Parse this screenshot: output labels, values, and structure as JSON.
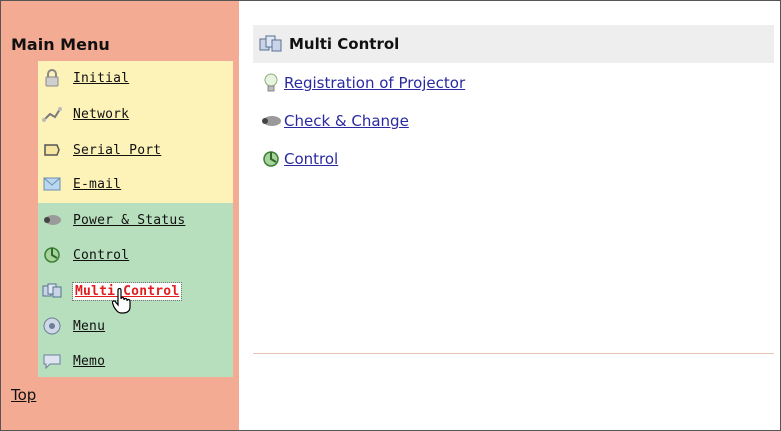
{
  "sidebar": {
    "title": "Main Menu",
    "items": [
      {
        "label": "Initial",
        "icon": "lock-icon"
      },
      {
        "label": "Network",
        "icon": "network-icon"
      },
      {
        "label": "Serial Port",
        "icon": "serial-port-icon"
      },
      {
        "label": "E-mail",
        "icon": "email-icon"
      },
      {
        "label": "Power & Status",
        "icon": "projector-icon"
      },
      {
        "label": "Control",
        "icon": "control-icon"
      },
      {
        "label": "Multi Control",
        "icon": "multi-control-icon",
        "active": true
      },
      {
        "label": "Menu",
        "icon": "menu-icon"
      },
      {
        "label": "Memo",
        "icon": "memo-icon"
      }
    ],
    "top_link": "Top"
  },
  "content": {
    "title": "Multi Control",
    "links": [
      {
        "label": "Registration of Projector",
        "icon": "bulb-icon"
      },
      {
        "label": "Check & Change",
        "icon": "projector-icon"
      },
      {
        "label": "Control",
        "icon": "control-icon"
      }
    ]
  },
  "colors": {
    "sidebar_bg": "#f4ab93",
    "group_yellow": "#fdf2b8",
    "group_green": "#b7dfbe",
    "active_label": "#e01e1e",
    "link": "#2a2aa0"
  }
}
